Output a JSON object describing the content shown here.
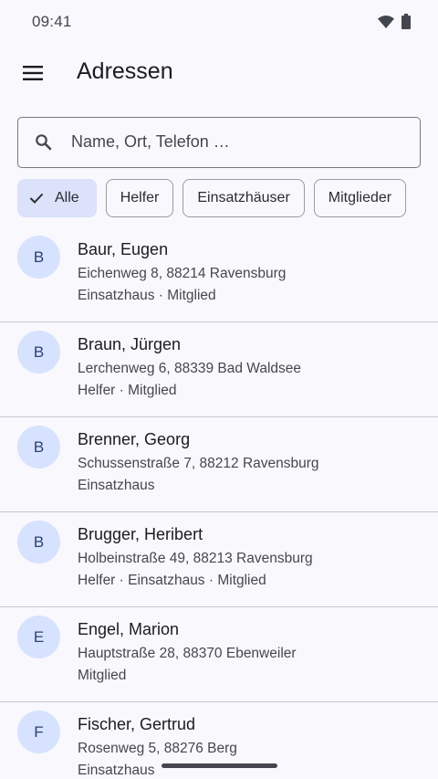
{
  "status_bar": {
    "time": "09:41"
  },
  "app_bar": {
    "title": "Adressen"
  },
  "search": {
    "placeholder": "Name, Ort, Telefon …",
    "value": ""
  },
  "filters": [
    {
      "label": "Alle",
      "selected": true
    },
    {
      "label": "Helfer",
      "selected": false
    },
    {
      "label": "Einsatzhäuser",
      "selected": false
    },
    {
      "label": "Mitglieder",
      "selected": false
    }
  ],
  "contacts": [
    {
      "initial": "B",
      "name": "Baur, Eugen",
      "address": "Eichenweg 8, 88214 Ravensburg",
      "tags": "Einsatzhaus · Mitglied"
    },
    {
      "initial": "B",
      "name": "Braun, Jürgen",
      "address": "Lerchenweg 6, 88339 Bad Waldsee",
      "tags": "Helfer · Mitglied"
    },
    {
      "initial": "B",
      "name": "Brenner, Georg",
      "address": "Schussenstraße 7, 88212 Ravensburg",
      "tags": "Einsatzhaus"
    },
    {
      "initial": "B",
      "name": "Brugger, Heribert",
      "address": "Holbeinstraße 49, 88213 Ravensburg",
      "tags": "Helfer · Einsatzhaus · Mitglied"
    },
    {
      "initial": "E",
      "name": "Engel, Marion",
      "address": "Hauptstraße 28, 88370 Ebenweiler",
      "tags": "Mitglied"
    },
    {
      "initial": "F",
      "name": "Fischer, Gertrud",
      "address": "Rosenweg 5, 88276 Berg",
      "tags": "Einsatzhaus"
    }
  ],
  "colors": {
    "accent_container": "#dbe2f9",
    "avatar_bg": "#d7e2ff",
    "avatar_text": "#2c4271",
    "background": "#f9f8fd"
  }
}
